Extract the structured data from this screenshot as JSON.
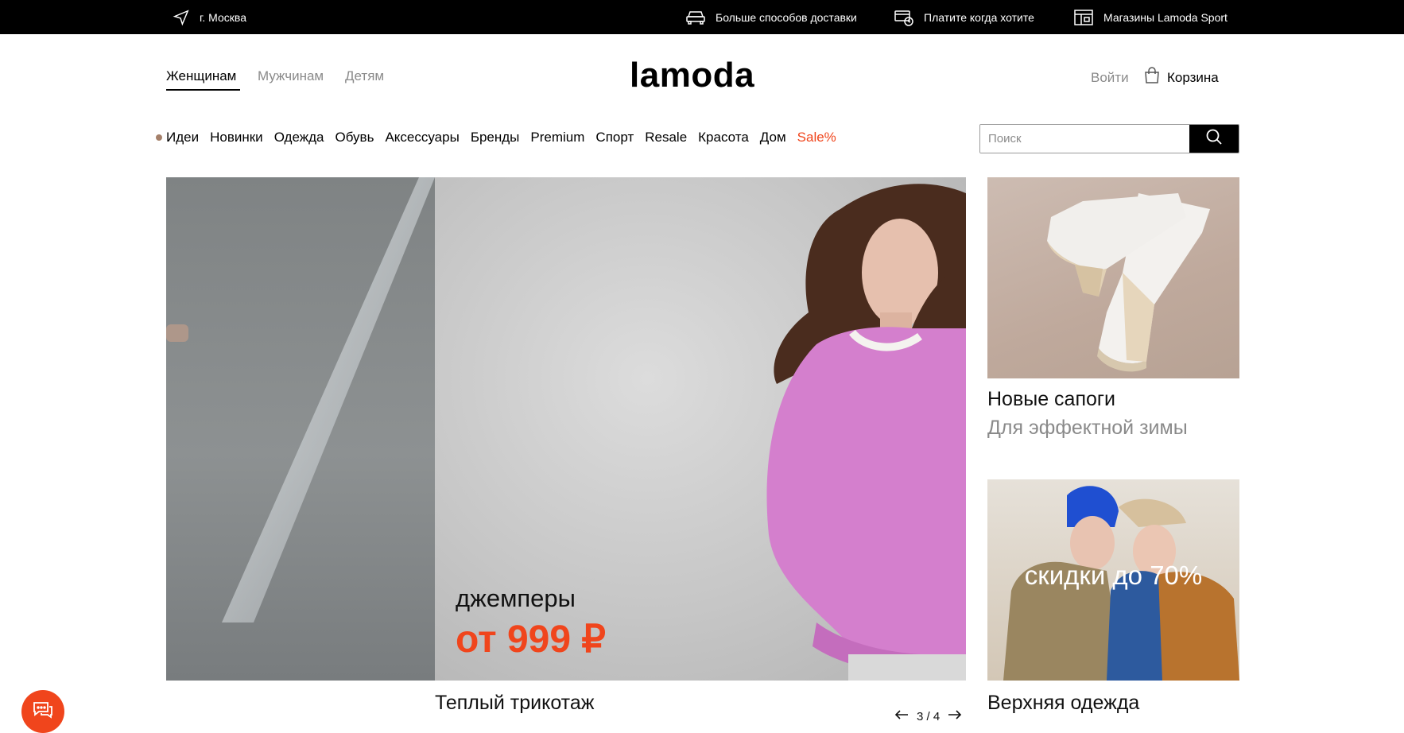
{
  "topbar": {
    "city": "г. Москва",
    "delivery": "Больше способов доставки",
    "pay": "Платите когда хотите",
    "stores": "Магазины Lamoda Sport"
  },
  "header": {
    "genders": [
      "Женщинам",
      "Мужчинам",
      "Детям"
    ],
    "active_gender": "Женщинам",
    "logo": "lamoda",
    "login": "Войти",
    "cart": "Корзина"
  },
  "nav": {
    "items": [
      "Идеи",
      "Новинки",
      "Одежда",
      "Обувь",
      "Аксессуары",
      "Бренды",
      "Premium",
      "Спорт",
      "Resale",
      "Красота",
      "Дом",
      "Sale%"
    ],
    "sale_color": "#f0451c",
    "ideas_dot_color": "#a5806a"
  },
  "search": {
    "placeholder": "Поиск",
    "value": ""
  },
  "hero": {
    "caption": "джемперы",
    "price": "от 999 ₽",
    "title": "Теплый трикотаж",
    "pager": "3 / 4"
  },
  "cards": {
    "boots_title": "Новые сапоги",
    "boots_sub": "Для эффектной зимы",
    "outerwear_promo": "скидки до 70%",
    "outerwear_title": "Верхняя одежда"
  },
  "colors": {
    "accent": "#f0451c",
    "muted_text": "#8a8a8a"
  },
  "icons": [
    "location-arrow-icon",
    "car-icon",
    "card-icon",
    "store-icon",
    "cart-icon",
    "search-icon",
    "arrow-left-icon",
    "arrow-right-icon",
    "chat-icon"
  ]
}
